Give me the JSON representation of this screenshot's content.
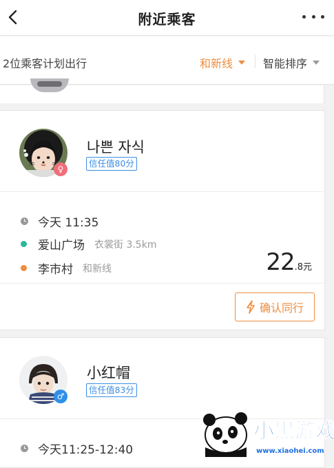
{
  "nav": {
    "title": "附近乘客",
    "back_icon": "chevron-left-icon",
    "more_icon": "more-dots-icon"
  },
  "filter": {
    "count_text": "2位乘客计划出行",
    "route_label": "和新线",
    "sort_label": "智能排序"
  },
  "passengers": [
    {
      "name": "나쁜 자식",
      "gender": "female",
      "gender_symbol": "♀",
      "trust": "信任值80分",
      "time": "今天 11:35",
      "origin": "爱山广场",
      "origin_detail": "衣裳街 3.5km",
      "destination": "李市村",
      "destination_detail": "和新线",
      "price_int": "22",
      "price_dec": ".8元",
      "action_label": "确认同行"
    },
    {
      "name": "小红帽",
      "gender": "male",
      "gender_symbol": "♂",
      "trust": "信任值83分",
      "time": "今天11:25-12:40"
    }
  ],
  "colors": {
    "accent": "#f08c3c",
    "trust_blue": "#3a8ee6",
    "origin_dot": "#26b99a",
    "dest_dot": "#f08c3c",
    "female": "#f06e7a",
    "male": "#2f8fe8"
  },
  "watermark": {
    "text": "小黑游戏",
    "url": "www.xiaohei.com"
  }
}
